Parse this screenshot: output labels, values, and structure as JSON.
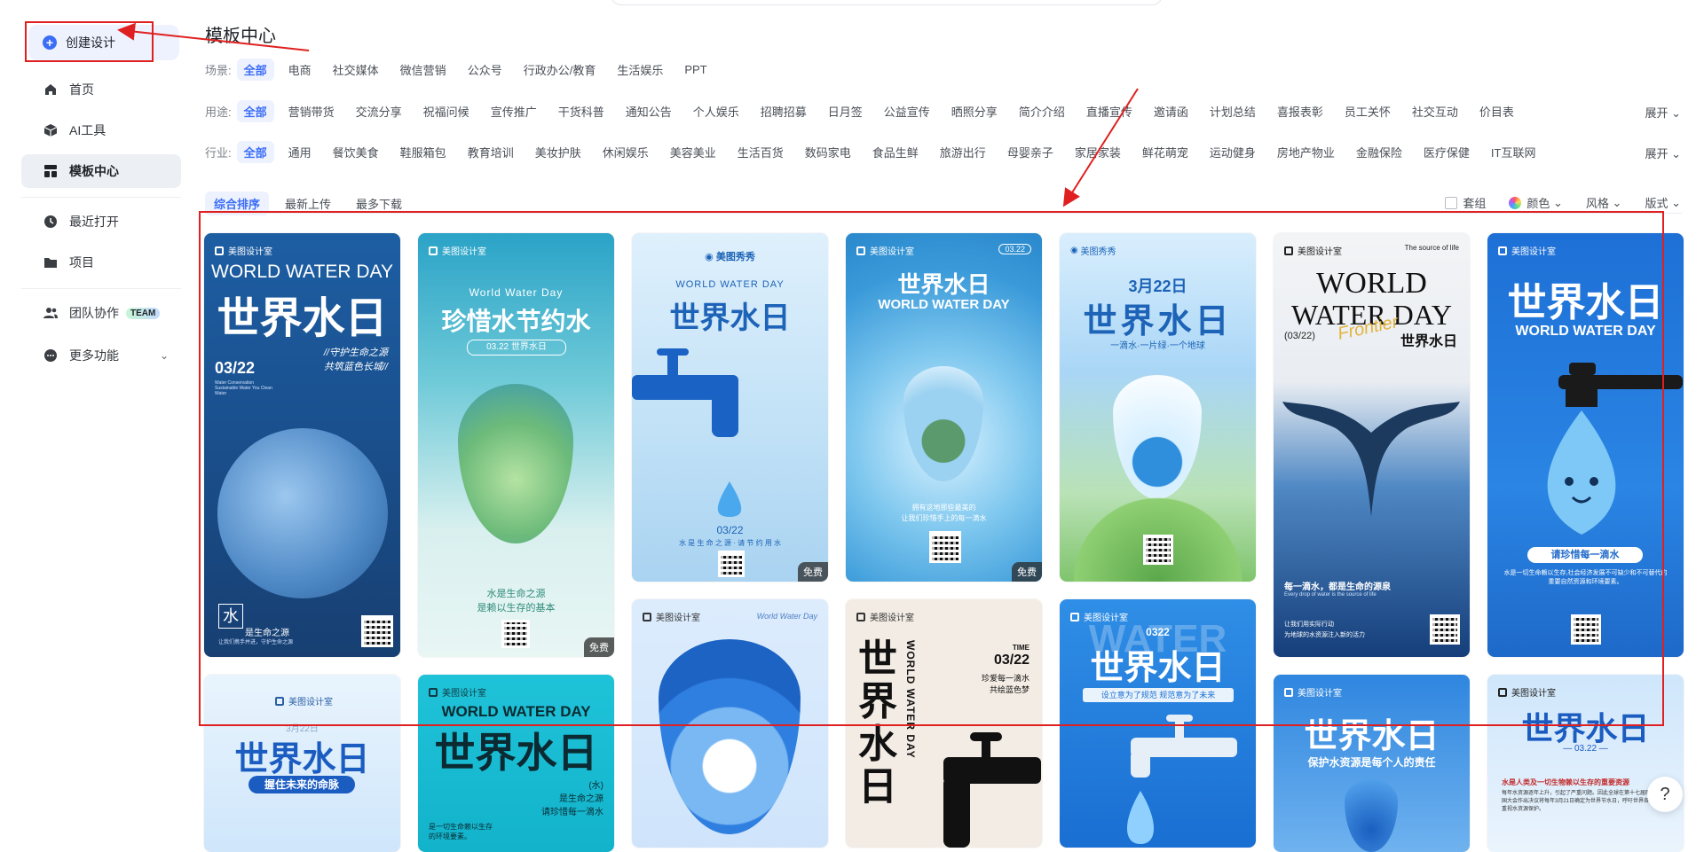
{
  "sidebar": {
    "create": "创建设计",
    "home": "首页",
    "ai_tools": "AI工具",
    "templates": "模板中心",
    "recent": "最近打开",
    "projects": "项目",
    "team": "团队协作",
    "team_badge": "TEAM",
    "more": "更多功能"
  },
  "page_title": "模板中心",
  "filters": {
    "scene": {
      "label": "场景:",
      "options": [
        "全部",
        "电商",
        "社交媒体",
        "微信营销",
        "公众号",
        "行政办公/教育",
        "生活娱乐",
        "PPT"
      ]
    },
    "usage": {
      "label": "用途:",
      "options": [
        "全部",
        "营销带货",
        "交流分享",
        "祝福问候",
        "宣传推广",
        "干货科普",
        "通知公告",
        "个人娱乐",
        "招聘招募",
        "日月签",
        "公益宣传",
        "晒照分享",
        "简介介绍",
        "直播宣传",
        "邀请函",
        "计划总结",
        "喜报表彰",
        "员工关怀",
        "社交互动",
        "价目表"
      ],
      "expand": "展开"
    },
    "industry": {
      "label": "行业:",
      "options": [
        "全部",
        "通用",
        "餐饮美食",
        "鞋服箱包",
        "教育培训",
        "美妆护肤",
        "休闲娱乐",
        "美容美业",
        "生活百货",
        "数码家电",
        "食品生鲜",
        "旅游出行",
        "母婴亲子",
        "家居家装",
        "鲜花萌宠",
        "运动健身",
        "房地产物业",
        "金融保险",
        "医疗保健",
        "IT互联网"
      ],
      "expand": "展开"
    }
  },
  "sort": {
    "options": [
      "综合排序",
      "最新上传",
      "最多下载"
    ],
    "set": "套组",
    "color": "颜色",
    "style": "风格",
    "layout": "版式"
  },
  "cards": {
    "c1": {
      "brand": "美图设计室",
      "en": "WORLD WATER DAY",
      "cn": "世界水日",
      "date": "03/22",
      "slogan1": "//守护生命之源",
      "slogan2": "共筑蓝色长城//",
      "small": "Water Conservation Sustainable Water You Clean Water",
      "char": "水",
      "foot": "是生命之源",
      "foot2": "让我们携手并进，守护生命之源"
    },
    "c2": {
      "brand": "美图设计室",
      "en": "World Water Day",
      "cn": "珍惜水节约水",
      "pill": "03.22 世界水日",
      "line1": "水是生命之源",
      "line2": "是赖以生存的基本",
      "free": "免费"
    },
    "c3": {
      "brand": "美图秀秀",
      "en": "WORLD WATER DAY",
      "cn": "世界水日",
      "date": "03/22",
      "line": "水 是 生 命 之 源 · 请 节 约 用 水",
      "free": "免费"
    },
    "c4": {
      "brand": "美图设计室",
      "tag": "03.22",
      "cn": "世界水日",
      "en": "WORLD WATER DAY",
      "line1": "拥有这地那些最美的",
      "line2": "让我们珍惜手上的每一滴水",
      "free": "免费"
    },
    "c5": {
      "brand": "美图秀秀",
      "date": "3月22日",
      "cn": "世界水日",
      "line": "一滴水·一片绿·一个地球"
    },
    "c6": {
      "brand": "美图设计室",
      "tr": "The source of life",
      "en1": "WORLD",
      "en2": "WATER DAY",
      "script": "Frontier",
      "date": "(03/22)",
      "cn": "世界水日",
      "line1": "每一滴水，都是生命的源泉",
      "line2": "Every drop of water is the source of life",
      "line3": "让我们用实际行动",
      "line4": "为地球的水资源注入新的活力"
    },
    "c7": {
      "brand": "美图设计室",
      "cn": "世界水日",
      "en": "WORLD WATER DAY",
      "line1": "请珍惜每一滴水",
      "line2": "水是一切生命赖以生存,社会经济发展不可缺少和不可替代的重要自然资源和环境要素。"
    },
    "c8": {
      "brand": "美图设计室",
      "cn": "世界水日",
      "sub": "3月22日",
      "line": "握住未来的命脉"
    },
    "c9": {
      "brand": "美图设计室",
      "en": "WORLD WATER DAY",
      "cn": "世界水日",
      "tag": "(水)",
      "r1": "是生命之源",
      "r2": "请珍惜每一滴水",
      "b1": "是一切生命赖以生存",
      "b2": "的环境要素。"
    },
    "c10": {
      "brand": "美图设计室",
      "tr": "World Water Day"
    },
    "c11": {
      "brand": "美图设计室",
      "vcn": "世界水日",
      "ven": "WORLD WATER DAY",
      "time": "TIME",
      "date": "03/22",
      "l1": "珍爱每一滴水",
      "l2": "共绘蓝色梦"
    },
    "c12": {
      "brand": "美图设计室",
      "bg": "WATER",
      "date": "0322",
      "cn": "世界水日",
      "line": "设立意为了规范 规范意为了未来"
    },
    "c13": {
      "brand": "美图设计室",
      "cn": "世界水日",
      "line": "保护水资源是每个人的责任"
    },
    "c14": {
      "brand": "美图设计室",
      "cn": "世界水日",
      "date": "— 03.22 —",
      "line1": "水是人类及一切生物赖以生存的重要资源",
      "line2": "每年水资源逐年上升，引起了严重问题。因此全球在第十七届联合国大会作出决议将每年3月21日确定为世界节水日，呼吁世界各国重视水资源保护。"
    }
  },
  "help": "?"
}
